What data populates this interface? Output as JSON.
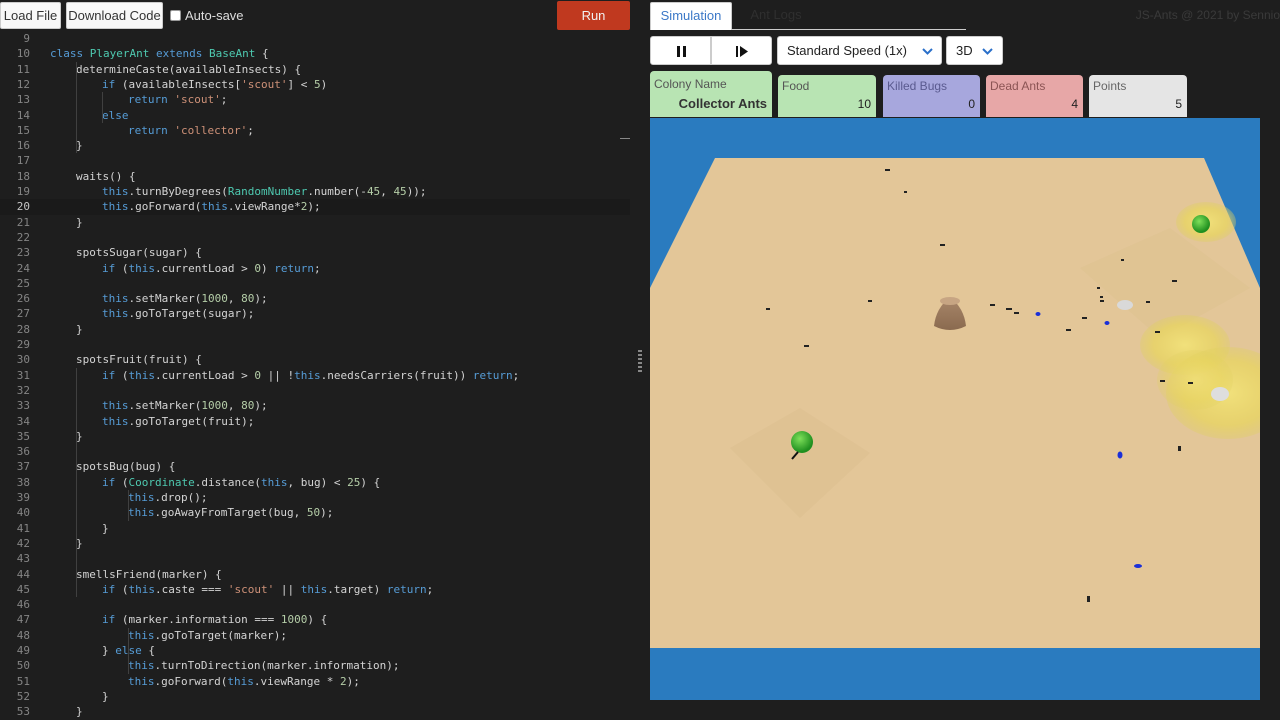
{
  "toolbar": {
    "load_label": "Load File",
    "download_label": "Download Code",
    "autosave_label": "Auto-save",
    "autosave_checked": false,
    "run_label": "Run"
  },
  "editor": {
    "active_line": 20,
    "lines": [
      {
        "n": 9,
        "indent": 0,
        "code": ""
      },
      {
        "n": 10,
        "indent": 0,
        "code": "<span class='k'>class</span> <span class='c'>PlayerAnt</span> <span class='k'>extends</span> <span class='c'>BaseAnt</span> {"
      },
      {
        "n": 11,
        "indent": 1,
        "code": "determineCaste(availableInsects) {"
      },
      {
        "n": 12,
        "indent": 2,
        "code": "<span class='k'>if</span> (availableInsects[<span class='s'>'scout'</span>] &lt; <span class='n'>5</span>)"
      },
      {
        "n": 13,
        "indent": 3,
        "code": "<span class='k'>return</span> <span class='s'>'scout'</span>;"
      },
      {
        "n": 14,
        "indent": 2,
        "code": "<span class='k'>else</span>"
      },
      {
        "n": 15,
        "indent": 3,
        "code": "<span class='k'>return</span> <span class='s'>'collector'</span>;"
      },
      {
        "n": 16,
        "indent": 1,
        "code": "}"
      },
      {
        "n": 17,
        "indent": 0,
        "code": ""
      },
      {
        "n": 18,
        "indent": 1,
        "code": "waits() {"
      },
      {
        "n": 19,
        "indent": 2,
        "code": "<span class='t'>this</span>.turnByDegrees(<span class='c'>RandomNumber</span>.number(-<span class='n'>45</span>, <span class='n'>45</span>));"
      },
      {
        "n": 20,
        "indent": 2,
        "code": "<span class='t'>this</span>.goForward(<span class='t'>this</span>.viewRange*<span class='n'>2</span>);"
      },
      {
        "n": 21,
        "indent": 1,
        "code": "}"
      },
      {
        "n": 22,
        "indent": 0,
        "code": ""
      },
      {
        "n": 23,
        "indent": 1,
        "code": "spotsSugar(sugar) {"
      },
      {
        "n": 24,
        "indent": 2,
        "code": "<span class='k'>if</span> (<span class='t'>this</span>.currentLoad &gt; <span class='n'>0</span>) <span class='k'>return</span>;"
      },
      {
        "n": 25,
        "indent": 0,
        "code": ""
      },
      {
        "n": 26,
        "indent": 2,
        "code": "<span class='t'>this</span>.setMarker(<span class='n'>1000</span>, <span class='n'>80</span>);"
      },
      {
        "n": 27,
        "indent": 2,
        "code": "<span class='t'>this</span>.goToTarget(sugar);"
      },
      {
        "n": 28,
        "indent": 1,
        "code": "}"
      },
      {
        "n": 29,
        "indent": 0,
        "code": ""
      },
      {
        "n": 30,
        "indent": 1,
        "code": "spotsFruit(fruit) {"
      },
      {
        "n": 31,
        "indent": 2,
        "code": "<span class='k'>if</span> (<span class='t'>this</span>.currentLoad &gt; <span class='n'>0</span> || !<span class='t'>this</span>.needsCarriers(fruit)) <span class='k'>return</span>;"
      },
      {
        "n": 32,
        "indent": 0,
        "code": ""
      },
      {
        "n": 33,
        "indent": 2,
        "code": "<span class='t'>this</span>.setMarker(<span class='n'>1000</span>, <span class='n'>80</span>);"
      },
      {
        "n": 34,
        "indent": 2,
        "code": "<span class='t'>this</span>.goToTarget(fruit);"
      },
      {
        "n": 35,
        "indent": 1,
        "code": "}"
      },
      {
        "n": 36,
        "indent": 0,
        "code": ""
      },
      {
        "n": 37,
        "indent": 1,
        "code": "spotsBug(bug) {"
      },
      {
        "n": 38,
        "indent": 2,
        "code": "<span class='k'>if</span> (<span class='c'>Coordinate</span>.distance(<span class='t'>this</span>, bug) &lt; <span class='n'>25</span>) {"
      },
      {
        "n": 39,
        "indent": 3,
        "code": "<span class='t'>this</span>.drop();"
      },
      {
        "n": 40,
        "indent": 3,
        "code": "<span class='t'>this</span>.goAwayFromTarget(bug, <span class='n'>50</span>);"
      },
      {
        "n": 41,
        "indent": 2,
        "code": "}"
      },
      {
        "n": 42,
        "indent": 1,
        "code": "}"
      },
      {
        "n": 43,
        "indent": 0,
        "code": ""
      },
      {
        "n": 44,
        "indent": 1,
        "code": "smellsFriend(marker) {"
      },
      {
        "n": 45,
        "indent": 2,
        "code": "<span class='k'>if</span> (<span class='t'>this</span>.caste === <span class='s'>'scout'</span> || <span class='t'>this</span>.target) <span class='k'>return</span>;"
      },
      {
        "n": 46,
        "indent": 0,
        "code": ""
      },
      {
        "n": 47,
        "indent": 2,
        "code": "<span class='k'>if</span> (marker.information === <span class='n'>1000</span>) {"
      },
      {
        "n": 48,
        "indent": 3,
        "code": "<span class='t'>this</span>.goToTarget(marker);"
      },
      {
        "n": 49,
        "indent": 2,
        "code": "} <span class='k'>else</span> {"
      },
      {
        "n": 50,
        "indent": 3,
        "code": "<span class='t'>this</span>.turnToDirection(marker.information);"
      },
      {
        "n": 51,
        "indent": 3,
        "code": "<span class='t'>this</span>.goForward(<span class='t'>this</span>.viewRange * <span class='n'>2</span>);"
      },
      {
        "n": 52,
        "indent": 2,
        "code": "}"
      },
      {
        "n": 53,
        "indent": 1,
        "code": "}"
      }
    ]
  },
  "tabs": {
    "simulation": "Simulation",
    "ant_logs": "Ant Logs"
  },
  "credit": "JS-Ants @ 2021 by Sennio",
  "controls": {
    "pause_icon": "pause-icon",
    "step_icon": "step-forward-icon",
    "speed_value": "Standard Speed (1x)",
    "view_value": "3D"
  },
  "stats": {
    "colony_label": "Colony Name",
    "colony_value": "Collector Ants",
    "food_label": "Food",
    "food_value": "10",
    "killed_label": "Killed Bugs",
    "killed_value": "0",
    "dead_label": "Dead Ants",
    "dead_value": "4",
    "points_label": "Points",
    "points_value": "5"
  },
  "colors": {
    "run": "#c0391f",
    "water": "#2a7bbf",
    "sand": "#e3c698",
    "colony_card": "#b8e4b3",
    "killed_card": "#a7a7dd",
    "dead_card": "#e7a7a7",
    "points_card": "#e5e5e5",
    "accent": "#3b78c7"
  }
}
